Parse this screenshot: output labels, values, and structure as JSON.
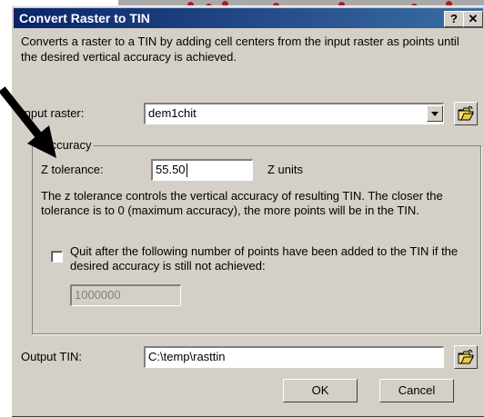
{
  "window": {
    "title": "Convert Raster to TIN",
    "help_label": "?",
    "close_label": "✕"
  },
  "description": "Converts a raster to a TIN by adding cell centers from the input raster as points until the desired vertical accuracy is achieved.",
  "input_raster": {
    "label": "Input raster:",
    "value": "dem1chit"
  },
  "accuracy": {
    "group_label": "Accuracy",
    "z_tolerance_label": "Z tolerance:",
    "z_tolerance_value": "55.50",
    "units_label": "Z units",
    "note": "The z tolerance controls the vertical accuracy of resulting TIN.  The closer the tolerance is to 0 (maximum accuracy), the more points will be in the TIN.",
    "quit_checkbox_label": "Quit after the following number of points have been added to the TIN if the desired accuracy is still not achieved:",
    "quit_checked": false,
    "max_points_value": "1000000"
  },
  "output_tin": {
    "label": "Output TIN:",
    "value": "C:\\temp\\rasttin"
  },
  "buttons": {
    "ok": "OK",
    "cancel": "Cancel"
  },
  "colors": {
    "title_bar_start": "#0a246a",
    "title_bar_end": "#3a6ea5",
    "dialog_face": "#d4d0c8"
  },
  "icons": {
    "open_folder": "open-folder-icon",
    "dropdown": "chevron-down-icon",
    "pointer": "arrow-pointer-icon"
  }
}
